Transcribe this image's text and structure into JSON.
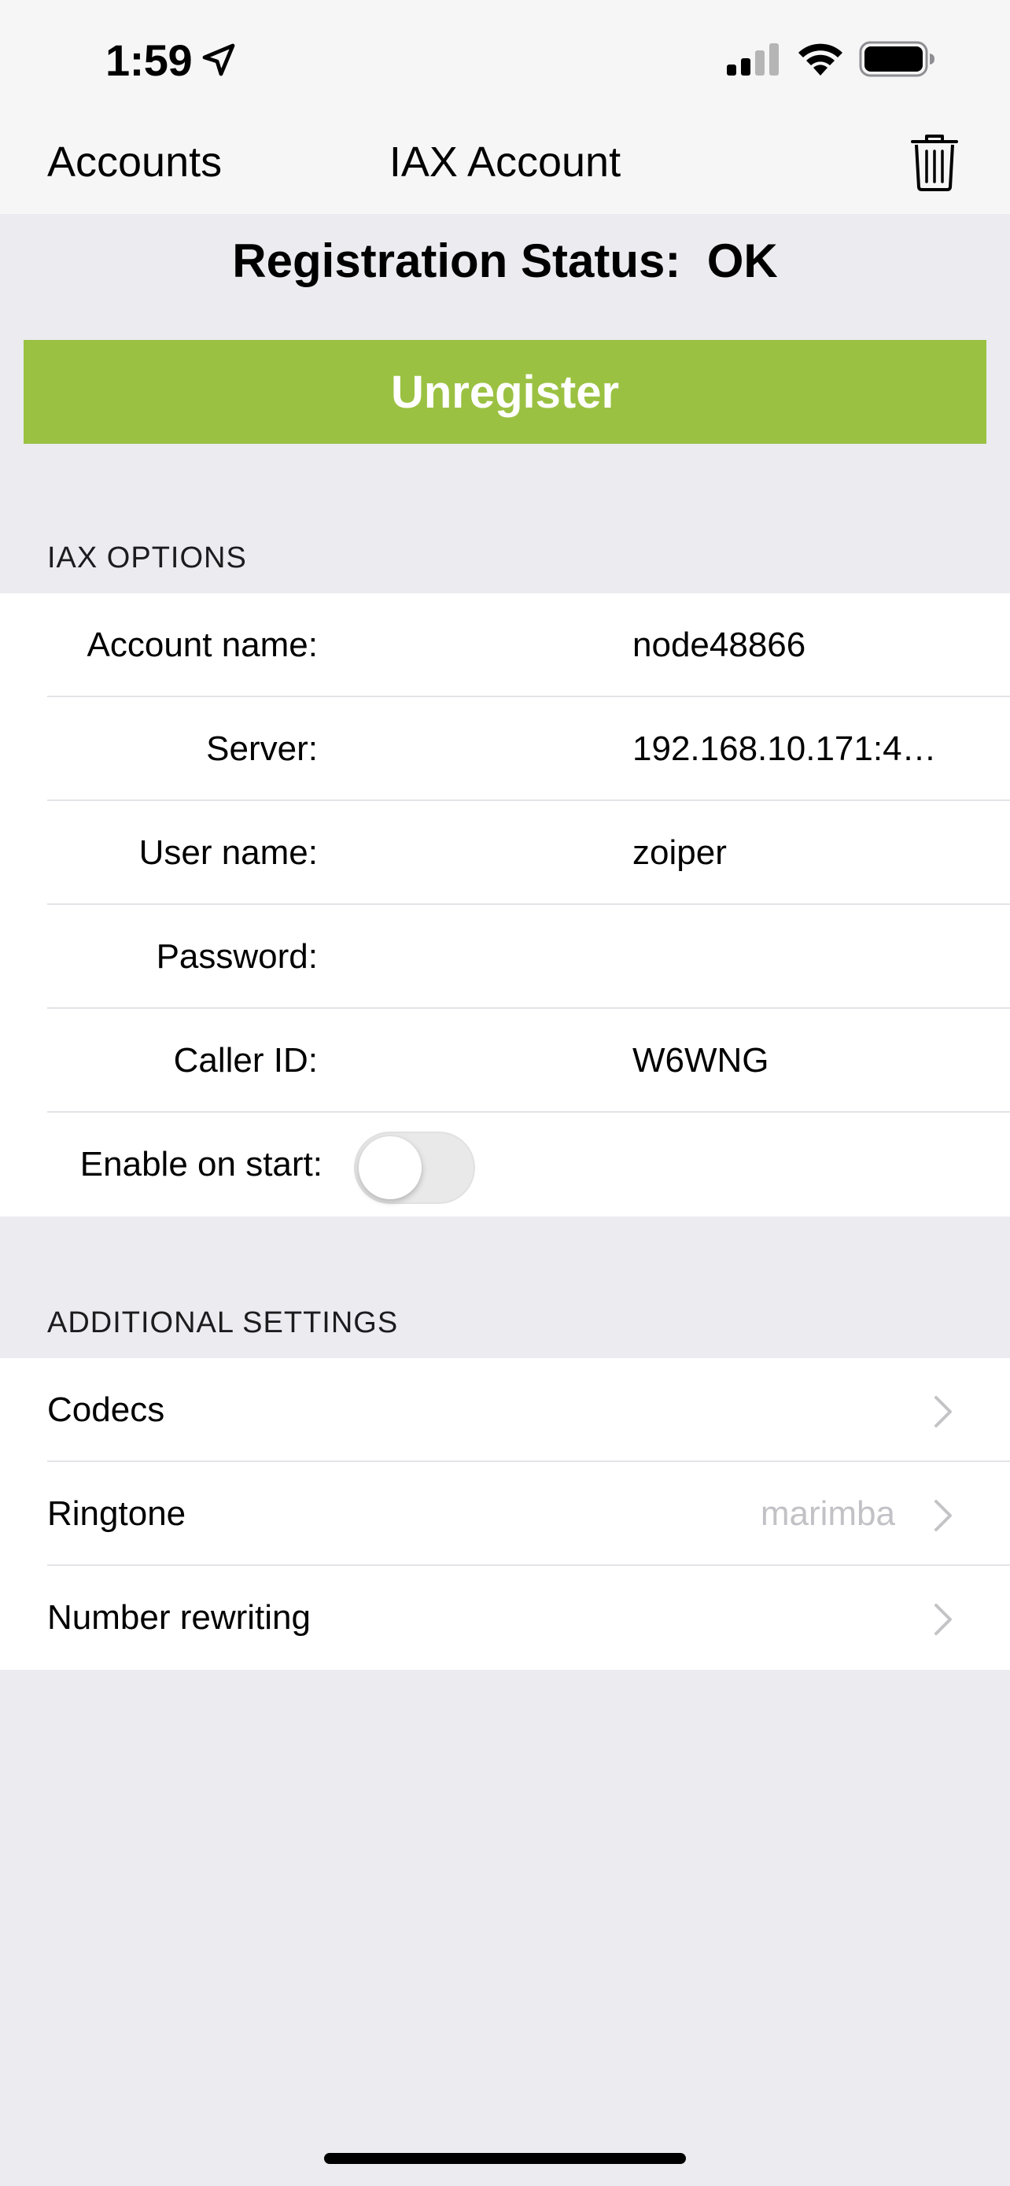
{
  "status_bar": {
    "time": "1:59",
    "icons": [
      "location-arrow-icon",
      "cellular-signal-icon",
      "wifi-icon",
      "battery-icon"
    ]
  },
  "nav": {
    "back_label": "Accounts",
    "title": "IAX Account",
    "action_icon": "trash-icon"
  },
  "registration": {
    "status_text": "Registration Status:  OK",
    "button_label": "Unregister",
    "button_color": "#9bc142"
  },
  "iax_options": {
    "header": "IAX OPTIONS",
    "fields": [
      {
        "label": "Account name:",
        "value": "node48866"
      },
      {
        "label": "Server:",
        "value": "192.168.10.171:4…"
      },
      {
        "label": "User name:",
        "value": "zoiper"
      },
      {
        "label": "Password:",
        "value": ""
      },
      {
        "label": "Caller ID:",
        "value": "W6WNG"
      }
    ],
    "enable_on_start": {
      "label": "Enable on start:",
      "on": false
    }
  },
  "additional_settings": {
    "header": "ADDITIONAL SETTINGS",
    "items": [
      {
        "label": "Codecs",
        "value": ""
      },
      {
        "label": "Ringtone",
        "value": "marimba"
      },
      {
        "label": "Number rewriting",
        "value": ""
      }
    ]
  }
}
